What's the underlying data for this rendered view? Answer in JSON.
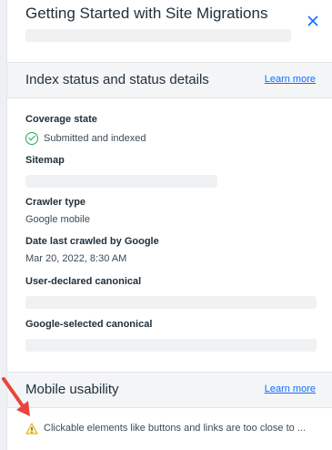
{
  "header": {
    "title": "Getting Started with Site Migrations",
    "close_icon": "close-icon"
  },
  "index_section": {
    "title": "Index status and status details",
    "learn_more": "Learn more"
  },
  "fields": {
    "coverage_state_label": "Coverage state",
    "coverage_state_value": "Submitted and indexed",
    "sitemap_label": "Sitemap",
    "crawler_type_label": "Crawler type",
    "crawler_type_value": "Google mobile",
    "date_crawled_label": "Date last crawled by Google",
    "date_crawled_value": "Mar 20, 2022, 8:30 AM",
    "user_canonical_label": "User-declared canonical",
    "google_canonical_label": "Google-selected canonical"
  },
  "mobile_section": {
    "title": "Mobile usability",
    "learn_more": "Learn more",
    "issue": "Clickable elements like buttons and links are too close to ..."
  },
  "colors": {
    "accent": "#116dff",
    "success": "#25a55a",
    "warning": "#f5b400",
    "arrow": "#e8453c"
  }
}
